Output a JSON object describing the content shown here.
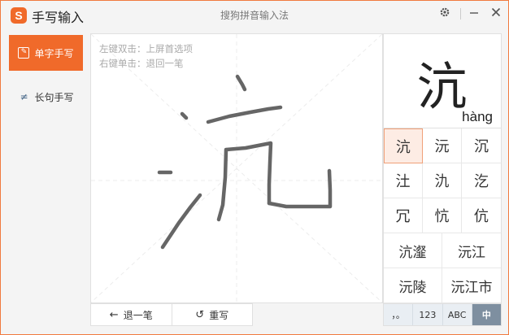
{
  "titlebar": {
    "logo_text": "S",
    "title": "手写输入",
    "center_title": "搜狗拼音输入法",
    "icons": [
      "gear-icon",
      "minimize-icon",
      "close-icon"
    ]
  },
  "sidebar": {
    "items": [
      {
        "label": "单字手写",
        "icon": "edit-box-icon",
        "active": true
      },
      {
        "label": "长句手写",
        "icon": "handwriting-icon",
        "active": false
      }
    ]
  },
  "pad": {
    "hint_line1": "左键双击：上屏首选项",
    "hint_line2": "右键单击：退回一笔",
    "undo_label": "退一笔",
    "rewrite_label": "重写"
  },
  "candidates": {
    "preview_char": "沆",
    "preview_pinyin": "hàng",
    "single": [
      "沆",
      "沅",
      "沉",
      "汢",
      "氿",
      "汔",
      "冗",
      "忼",
      "伉"
    ],
    "selected_index": 0,
    "words": [
      "沆瀣",
      "沅江",
      "沅陵",
      "沅江市"
    ],
    "modes": [
      {
        "label": "，。",
        "active": false
      },
      {
        "label": "123",
        "active": false
      },
      {
        "label": "ABC",
        "active": false
      },
      {
        "label": "中",
        "active": true
      }
    ]
  },
  "colors": {
    "accent": "#f06a2a",
    "stroke": "#666666",
    "mode_active": "#7e8fa0"
  }
}
